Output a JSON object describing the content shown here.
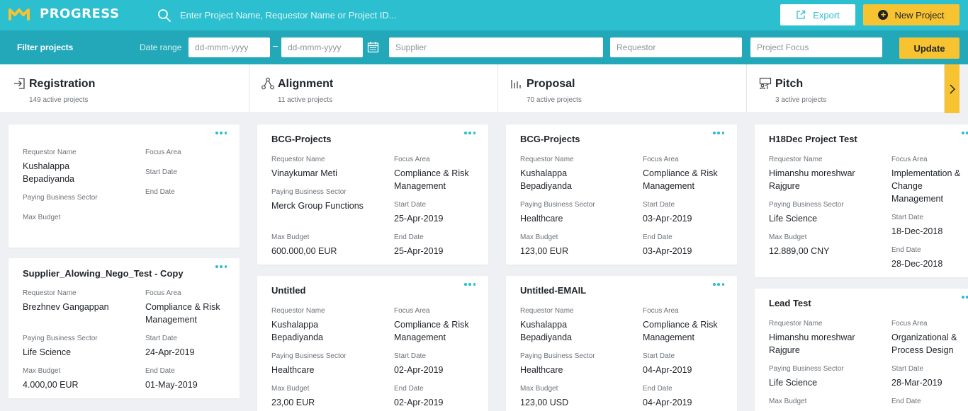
{
  "app": {
    "brand": "PROGRESS"
  },
  "search": {
    "placeholder": "Enter Project Name, Requestor Name or Project ID..."
  },
  "actions": {
    "export_label": "Export",
    "new_project_label": "New Project",
    "update_label": "Update"
  },
  "filters": {
    "title": "Filter projects",
    "date_range_label": "Date range",
    "date_from_placeholder": "dd-mmm-yyyy",
    "date_to_placeholder": "dd-mmm-yyyy",
    "date_separator": "–",
    "supplier_placeholder": "Supplier",
    "requestor_placeholder": "Requestor",
    "focus_placeholder": "Project Focus"
  },
  "colors": {
    "accent": "#2bbfcf",
    "accent_dark": "#23a8b9",
    "highlight": "#f8c331"
  },
  "labels": {
    "requestor": "Requestor Name",
    "focus": "Focus Area",
    "sector": "Paying Business Sector",
    "start": "Start Date",
    "budget": "Max Budget",
    "end": "End Date"
  },
  "stages": [
    {
      "title": "Registration",
      "subtitle": "149 active projects",
      "icon": "register-icon"
    },
    {
      "title": "Alignment",
      "subtitle": "11 active projects",
      "icon": "alignment-icon"
    },
    {
      "title": "Proposal",
      "subtitle": "70 active projects",
      "icon": "proposal-icon"
    },
    {
      "title": "Pitch",
      "subtitle": "3 active projects",
      "icon": "pitch-icon"
    }
  ],
  "cards": {
    "c0a": {
      "title": "",
      "requestor": "Kushalappa Bepadiyanda",
      "focus": "",
      "sector": "",
      "start": "",
      "budget": "",
      "end": ""
    },
    "c0b": {
      "title": "Supplier_Alowing_Nego_Test - Copy",
      "requestor": "Brezhnev Gangappan",
      "focus": "Compliance & Risk Management",
      "sector": "Life Science",
      "start": "24-Apr-2019",
      "budget": "4.000,00 EUR",
      "end": "01-May-2019"
    },
    "c1a": {
      "title": "BCG-Projects",
      "requestor": "Vinaykumar Meti",
      "focus": "Compliance & Risk Management",
      "sector": "Merck Group Functions",
      "start": "25-Apr-2019",
      "budget": "600.000,00 EUR",
      "end": "25-Apr-2019"
    },
    "c1b": {
      "title": "Untitled",
      "requestor": "Kushalappa Bepadiyanda",
      "focus": "Compliance & Risk Management",
      "sector": "Healthcare",
      "start": "02-Apr-2019",
      "budget": "23,00 EUR",
      "end": "02-Apr-2019"
    },
    "c2a": {
      "title": "BCG-Projects",
      "requestor": "Kushalappa Bepadiyanda",
      "focus": "Compliance & Risk Management",
      "sector": "Healthcare",
      "start": "03-Apr-2019",
      "budget": "123,00 EUR",
      "end": "03-Apr-2019"
    },
    "c2b": {
      "title": "Untitled-EMAIL",
      "requestor": "Kushalappa Bepadiyanda",
      "focus": "Compliance & Risk Management",
      "sector": "Healthcare",
      "start": "04-Apr-2019",
      "budget": "123,00 USD",
      "end": "04-Apr-2019"
    },
    "c3a": {
      "title": "H18Dec Project Test",
      "requestor": "Himanshu moreshwar Rajgure",
      "focus": "Implementation & Change Management",
      "sector": "Life Science",
      "start": "18-Dec-2018",
      "budget": "12.889,00 CNY",
      "end": "28-Dec-2018"
    },
    "c3b": {
      "title": "Lead Test",
      "requestor": "Himanshu moreshwar Rajgure",
      "focus": "Organizational & Process Design",
      "sector": "Life Science",
      "start": "28-Mar-2019",
      "budget": "",
      "end": ""
    }
  }
}
